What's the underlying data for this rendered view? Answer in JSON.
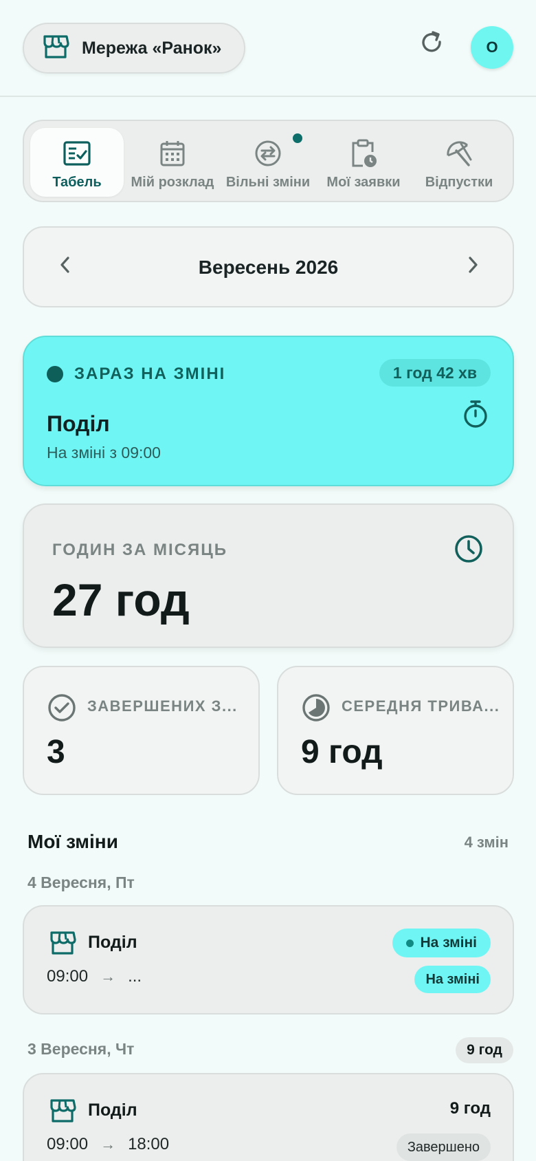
{
  "header": {
    "org_name": "Мережа «Ранок»",
    "avatar_initial": "О"
  },
  "tabs": [
    {
      "label": "Табель",
      "icon": "timesheet-icon",
      "active": true
    },
    {
      "label": "Мій розклад",
      "icon": "calendar-icon",
      "active": false
    },
    {
      "label": "Вільні зміни",
      "icon": "swap-icon",
      "active": false,
      "notification": true
    },
    {
      "label": "Мої заявки",
      "icon": "clipboard-clock-icon",
      "active": false
    },
    {
      "label": "Відпустки",
      "icon": "umbrella-off-icon",
      "active": false
    }
  ],
  "month": {
    "title": "Вересень 2026"
  },
  "current_shift": {
    "status_label": "ЗАРАЗ НА ЗМІНІ",
    "duration": "1 год 42 хв",
    "place": "Поділ",
    "since": "На зміні з 09:00"
  },
  "hours_card": {
    "label": "ГОДИН ЗА МІСЯЦЬ",
    "value": "27 год"
  },
  "stats": {
    "completed": {
      "label": "ЗАВЕРШЕНИХ З...",
      "value": "3"
    },
    "average": {
      "label": "СЕРЕДНЯ ТРИВА...",
      "value": "9 год"
    }
  },
  "shifts_section": {
    "title": "Мої зміни",
    "count": "4 змін"
  },
  "days": [
    {
      "label": "4 Вересня, Пт",
      "shift": {
        "place": "Поділ",
        "start": "09:00",
        "end": "...",
        "live_badge": "На зміні",
        "status_badge": "На зміні"
      }
    },
    {
      "label": "3 Вересня, Чт",
      "day_hours": "9 год",
      "shift": {
        "place": "Поділ",
        "start": "09:00",
        "end": "18:00",
        "hours": "9 год",
        "status_badge": "Завершено"
      }
    }
  ],
  "colors": {
    "accent": "#6ff6f4",
    "accent_dark": "#0c5f5d",
    "background": "#f2fbf9",
    "card": "#eceeed"
  }
}
